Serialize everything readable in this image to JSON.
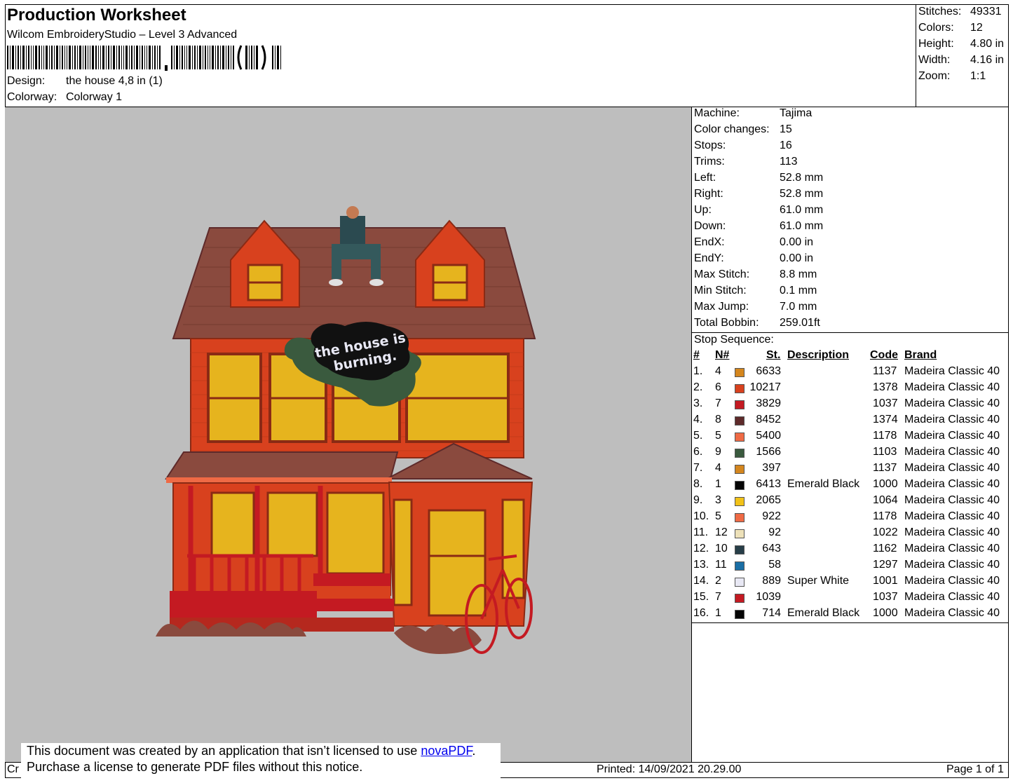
{
  "header": {
    "title": "Production Worksheet",
    "subtitle": "Wilcom EmbroideryStudio – Level 3 Advanced",
    "design_label": "Design:",
    "design_value": "the house 4,8 in (1)",
    "colorway_label": "Colorway:",
    "colorway_value": "Colorway 1"
  },
  "stats": [
    {
      "label": "Stitches:",
      "value": "49331"
    },
    {
      "label": "Colors:",
      "value": "12"
    },
    {
      "label": "Height:",
      "value": "4.80 in"
    },
    {
      "label": "Width:",
      "value": "4.16 in"
    },
    {
      "label": "Zoom:",
      "value": "1:1"
    }
  ],
  "machine_info": [
    {
      "label": "Machine:",
      "value": "Tajima"
    },
    {
      "label": "Color changes:",
      "value": "15"
    },
    {
      "label": "Stops:",
      "value": "16"
    },
    {
      "label": "Trims:",
      "value": "113"
    },
    {
      "label": "Left:",
      "value": "52.8 mm"
    },
    {
      "label": "Right:",
      "value": "52.8 mm"
    },
    {
      "label": "Up:",
      "value": "61.0 mm"
    },
    {
      "label": "Down:",
      "value": "61.0 mm"
    },
    {
      "label": "EndX:",
      "value": "0.00 in"
    },
    {
      "label": "EndY:",
      "value": "0.00 in"
    },
    {
      "label": "Max Stitch:",
      "value": "8.8 mm"
    },
    {
      "label": "Min Stitch:",
      "value": "0.1 mm"
    },
    {
      "label": "Max Jump:",
      "value": "7.0 mm"
    },
    {
      "label": "Total Bobbin:",
      "value": "259.01ft"
    }
  ],
  "stop_sequence": {
    "title": "Stop Sequence:",
    "columns": {
      "num": "#",
      "needle": "N#",
      "stitches": "St.",
      "description": "Description",
      "code": "Code",
      "brand": "Brand"
    },
    "rows": [
      {
        "num": "1.",
        "needle": "4",
        "color": "#d4861e",
        "stitches": "6633",
        "description": "",
        "code": "1137",
        "brand": "Madeira Classic 40"
      },
      {
        "num": "2.",
        "needle": "6",
        "color": "#d8411e",
        "stitches": "10217",
        "description": "",
        "code": "1378",
        "brand": "Madeira Classic 40"
      },
      {
        "num": "3.",
        "needle": "7",
        "color": "#c41a22",
        "stitches": "3829",
        "description": "",
        "code": "1037",
        "brand": "Madeira Classic 40"
      },
      {
        "num": "4.",
        "needle": "8",
        "color": "#5e2a2a",
        "stitches": "8452",
        "description": "",
        "code": "1374",
        "brand": "Madeira Classic 40"
      },
      {
        "num": "5.",
        "needle": "5",
        "color": "#ef6a45",
        "stitches": "5400",
        "description": "",
        "code": "1178",
        "brand": "Madeira Classic 40"
      },
      {
        "num": "6.",
        "needle": "9",
        "color": "#3a5a3e",
        "stitches": "1566",
        "description": "",
        "code": "1103",
        "brand": "Madeira Classic 40"
      },
      {
        "num": "7.",
        "needle": "4",
        "color": "#d4861e",
        "stitches": "397",
        "description": "",
        "code": "1137",
        "brand": "Madeira Classic 40"
      },
      {
        "num": "8.",
        "needle": "1",
        "color": "#050505",
        "stitches": "6413",
        "description": "Emerald Black",
        "code": "1000",
        "brand": "Madeira Classic 40"
      },
      {
        "num": "9.",
        "needle": "3",
        "color": "#f2c218",
        "stitches": "2065",
        "description": "",
        "code": "1064",
        "brand": "Madeira Classic 40"
      },
      {
        "num": "10.",
        "needle": "5",
        "color": "#ef6a45",
        "stitches": "922",
        "description": "",
        "code": "1178",
        "brand": "Madeira Classic 40"
      },
      {
        "num": "11.",
        "needle": "12",
        "color": "#ede1b9",
        "stitches": "92",
        "description": "",
        "code": "1022",
        "brand": "Madeira Classic 40"
      },
      {
        "num": "12.",
        "needle": "10",
        "color": "#273e48",
        "stitches": "643",
        "description": "",
        "code": "1162",
        "brand": "Madeira Classic 40"
      },
      {
        "num": "13.",
        "needle": "11",
        "color": "#1a6ea5",
        "stitches": "58",
        "description": "",
        "code": "1297",
        "brand": "Madeira Classic 40"
      },
      {
        "num": "14.",
        "needle": "2",
        "color": "#e8e8f4",
        "stitches": "889",
        "description": "Super White",
        "code": "1001",
        "brand": "Madeira Classic 40"
      },
      {
        "num": "15.",
        "needle": "7",
        "color": "#c41a22",
        "stitches": "1039",
        "description": "",
        "code": "1037",
        "brand": "Madeira Classic 40"
      },
      {
        "num": "16.",
        "needle": "1",
        "color": "#050505",
        "stitches": "714",
        "description": "Emerald Black",
        "code": "1000",
        "brand": "Madeira Classic 40"
      }
    ]
  },
  "preview": {
    "background": "#bebebe",
    "embroidery_text_line1": "the house is",
    "embroidery_text_line2": "burning."
  },
  "notice": {
    "line1_prefix": "This document was created by an application that isn’t licensed to use ",
    "link": "novaPDF",
    "line1_suffix": ".",
    "line2": "Purchase a license to generate PDF files without this notice."
  },
  "footer": {
    "left_fragment": "Cr",
    "printed": "Printed: 14/09/2021 20.29.00",
    "page": "Page 1 of 1"
  }
}
